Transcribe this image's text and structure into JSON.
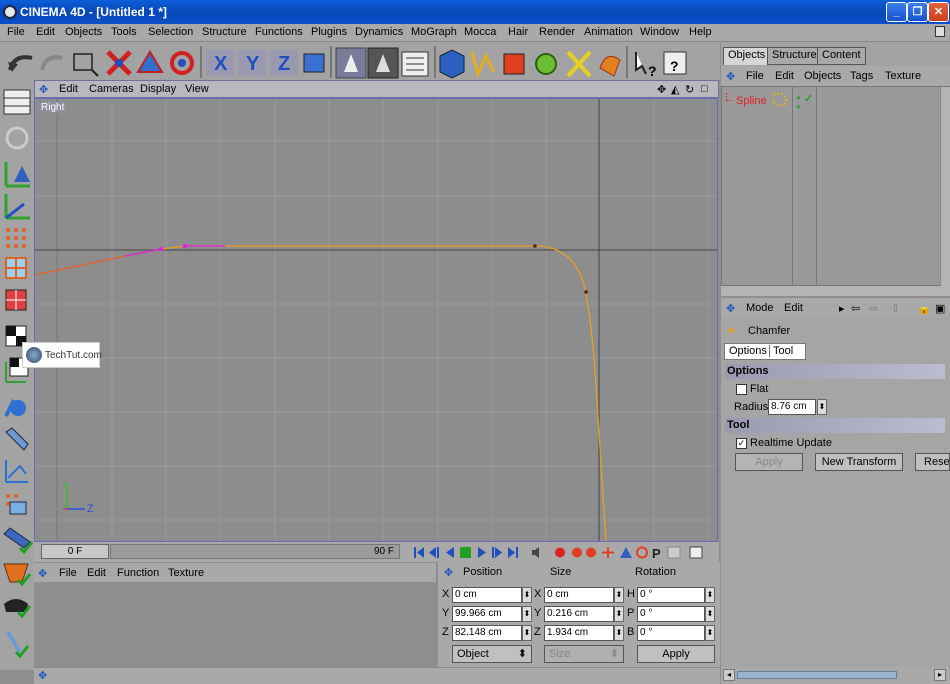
{
  "window": {
    "title": "CINEMA 4D - [Untitled 1 *]",
    "minimize": "_",
    "maximize": "❐",
    "close": "✕"
  },
  "menu": [
    "File",
    "Edit",
    "Objects",
    "Tools",
    "Selection",
    "Structure",
    "Functions",
    "Plugins",
    "Dynamics",
    "MoGraph",
    "Mocca",
    "Hair",
    "Render",
    "Animation",
    "Window",
    "Help"
  ],
  "toolbar": {
    "icons": [
      "undo-icon",
      "redo-icon",
      "select-rect-icon",
      "move-icon",
      "scale-icon",
      "rotate-icon",
      "x-axis-icon",
      "y-axis-icon",
      "z-axis-icon",
      "coordinate-system-icon",
      "render-view-icon",
      "render-picture-viewer-icon",
      "render-settings-icon",
      "cube-icon",
      "spline-icon",
      "nurbs-icon",
      "array-icon",
      "deformer-icon",
      "scene-icon",
      "light-icon",
      "help-cursor-icon",
      "help-icon"
    ]
  },
  "left_tools": [
    "viewport-layout-icon",
    "object-mode-icon",
    "model-mode-icon",
    "object-axis-icon",
    "points-mode-icon",
    "edges-mode-icon",
    "polygons-mode-icon",
    "texture-mode-icon",
    "texture-axis-icon",
    "animation-icon",
    "paint-icon",
    "inverse-kinematics-icon",
    "soft-ik-icon",
    "enable-axis-icon",
    "magnet-icon",
    "snap-icon",
    "bake-icon",
    "check-icon"
  ],
  "viewport": {
    "menu": [
      "Edit",
      "Cameras",
      "Display",
      "View"
    ],
    "label": "Right",
    "axis_y": "Y",
    "axis_z": "Z",
    "watermark": "TechTut.com"
  },
  "timeline": {
    "start": "0 F",
    "end": "90 F"
  },
  "materials": {
    "menu": [
      "File",
      "Edit",
      "Function",
      "Texture"
    ]
  },
  "coordinates": {
    "headers": [
      "Position",
      "Size",
      "Rotation"
    ],
    "rows": [
      {
        "axis": "X",
        "position": "0 cm",
        "size_axis": "X",
        "size": "0 cm",
        "rot_axis": "H",
        "rotation": "0 °"
      },
      {
        "axis": "Y",
        "position": "99.966 cm",
        "size_axis": "Y",
        "size": "0.216 cm",
        "rot_axis": "P",
        "rotation": "0 °"
      },
      {
        "axis": "Z",
        "position": "82.148 cm",
        "size_axis": "Z",
        "size": "1.934 cm",
        "rot_axis": "B",
        "rotation": "0 °"
      }
    ],
    "mode": "Object",
    "size_mode": "Size",
    "apply": "Apply"
  },
  "object_manager": {
    "tabs": [
      "Objects",
      "Structure",
      "Content"
    ],
    "menu": [
      "File",
      "Edit",
      "Objects",
      "Tags",
      "Texture"
    ],
    "objects": [
      {
        "name": "Spline",
        "color": "#e02020"
      }
    ]
  },
  "attributes": {
    "menu": [
      "Mode",
      "Edit"
    ],
    "tool_name": "Chamfer",
    "tabs": [
      "Options",
      "Tool"
    ],
    "options_header": "Options",
    "flat_label": "Flat",
    "flat_checked": false,
    "radius_label": "Radius",
    "radius_value": "8.76 cm",
    "tool_header": "Tool",
    "realtime_label": "Realtime Update",
    "realtime_checked": true,
    "apply": "Apply",
    "new_transform": "New Transform",
    "reset": "Rese"
  },
  "colors": {
    "spline": "#e8a020",
    "selected_points": "#e020e0",
    "spline_left": "#e86020"
  }
}
